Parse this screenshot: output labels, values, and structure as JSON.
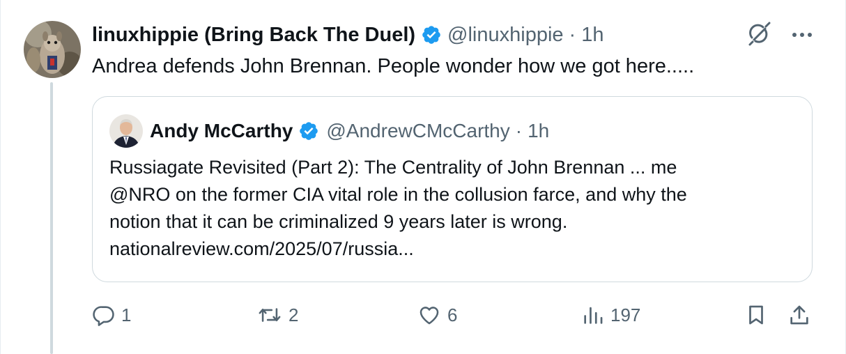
{
  "tweet": {
    "author": {
      "display_name": "linuxhippie (Bring Back The Duel)",
      "handle": "@linuxhippie",
      "time": "1h",
      "avatar_icon": "squirrel-avatar"
    },
    "separator": "·",
    "text": "Andrea defends John Brennan.  People wonder how we got here.....",
    "quote": {
      "author": {
        "display_name": "Andy McCarthy",
        "handle": "@AndrewCMcCarthy",
        "time": "1h",
        "avatar_icon": "portrait-avatar"
      },
      "lines": [
        "Russiagate Revisited (Part 2): The Centrality of John Brennan ... me",
        "@NRO on the former CIA vital role in the collusion farce, and why the",
        "notion that it can be criminalized 9 years later is wrong.",
        "nationalreview.com/2025/07/russia..."
      ]
    },
    "actions": {
      "replies": "1",
      "reposts": "2",
      "likes": "6",
      "views": "197"
    }
  },
  "colors": {
    "verified_blue": "#1d9bf0",
    "text_primary": "#0f1419",
    "text_secondary": "#536471",
    "border": "#cfd9de"
  }
}
